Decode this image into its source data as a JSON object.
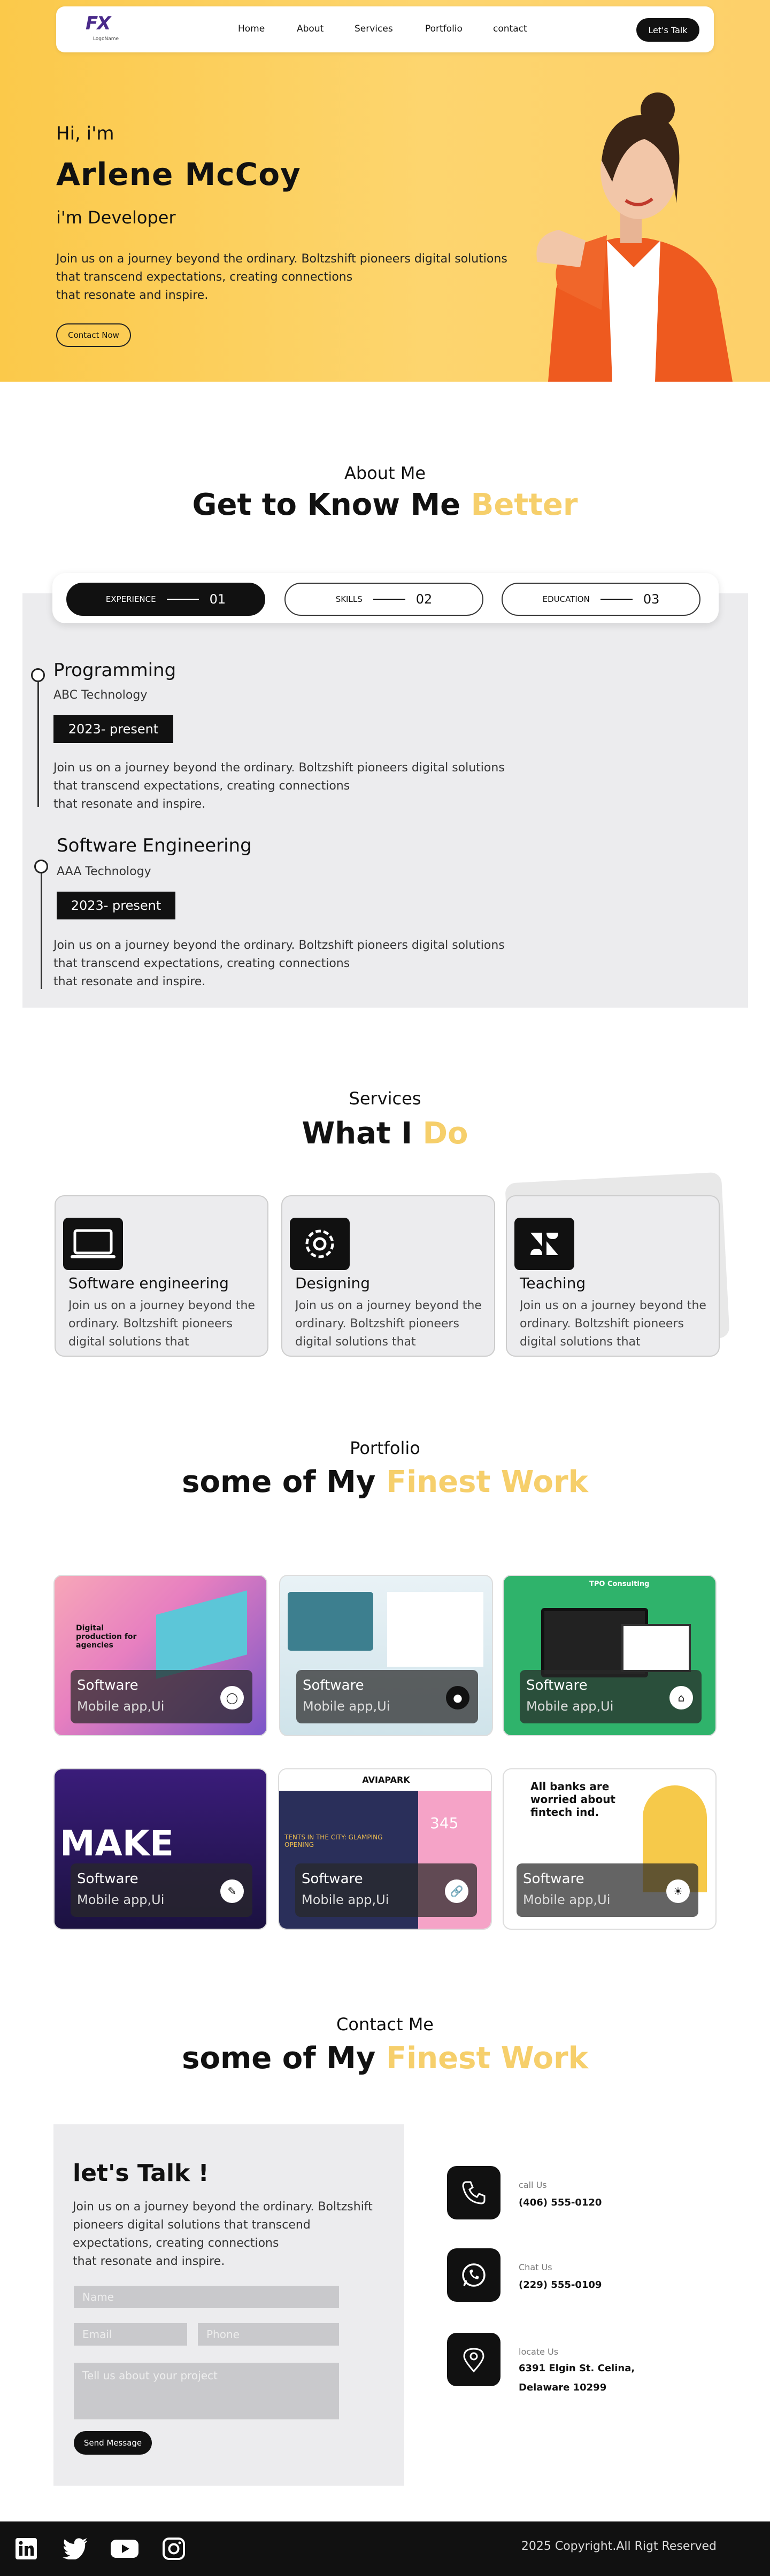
{
  "nav": {
    "logo_mark": "FX",
    "logo_sub": "LogoName",
    "links": [
      "Home",
      "About",
      "Services",
      "Portfolio",
      "contact"
    ],
    "cta": "Let's Talk"
  },
  "hero": {
    "greeting": "Hi, i'm",
    "name": "Arlene McCoy",
    "role": "i'm Developer",
    "desc_lines": [
      "Join us on a journey beyond the ordinary. Boltzshift pioneers digital solutions",
      "that transcend expectations, creating connections",
      "that resonate and inspire."
    ],
    "button": "Contact Now"
  },
  "about": {
    "sub": "About Me",
    "title_main": "Get to Know Me",
    "title_highlight": "Better",
    "tabs": [
      {
        "label": "EXPERIENCE",
        "num": "01"
      },
      {
        "label": "SKILLS",
        "num": "02"
      },
      {
        "label": "EDUCATION",
        "num": "03"
      }
    ],
    "items": [
      {
        "title": "Programming",
        "org": "ABC Technology",
        "date": "2023- present",
        "desc_lines": [
          "Join us on a journey beyond the ordinary. Boltzshift pioneers digital solutions",
          "that transcend expectations, creating connections",
          "that resonate and inspire."
        ]
      },
      {
        "title": "Software Engineering",
        "org": "AAA Technology",
        "date": "2023- present",
        "desc_lines": [
          "Join us on a journey beyond the ordinary. Boltzshift pioneers digital solutions",
          "that transcend expectations, creating connections",
          "that resonate and inspire."
        ]
      }
    ]
  },
  "services": {
    "sub": "Services",
    "title_main": "What I",
    "title_highlight": "Do",
    "cards": [
      {
        "title": "Software engineering",
        "desc": "Join us on a journey beyond the ordinary. Boltzshift pioneers digital solutions that",
        "icon": "laptop-icon"
      },
      {
        "title": "Designing",
        "desc": "Join us on a journey beyond the ordinary. Boltzshift pioneers digital solutions that",
        "icon": "gear-icon"
      },
      {
        "title": "Teaching",
        "desc": "Join us on a journey beyond the ordinary. Boltzshift pioneers digital solutions that",
        "icon": "zendesk-icon"
      }
    ]
  },
  "portfolio": {
    "sub": "Portfolio",
    "title_main": "some of My",
    "title_highlight": "Finest Work",
    "items": [
      {
        "title": "Software",
        "subtitle": "Mobile app,Ui",
        "icon": "instagram-icon",
        "thumb_text": "Digital production for agencies"
      },
      {
        "title": "Software",
        "subtitle": "Mobile app,Ui",
        "icon": "android-icon",
        "thumb_text": ""
      },
      {
        "title": "Software",
        "subtitle": "Mobile app,Ui",
        "icon": "home-icon",
        "thumb_text": "TPO Consulting"
      },
      {
        "title": "Software",
        "subtitle": "Mobile app,Ui",
        "icon": "pen-icon",
        "thumb_text": "MAKE"
      },
      {
        "title": "Software",
        "subtitle": "Mobile app,Ui",
        "icon": "link-icon",
        "thumb_text": "AVIAPARK"
      },
      {
        "title": "Software",
        "subtitle": "Mobile app,Ui",
        "icon": "sun-icon",
        "thumb_text": "All banks are worried about fintech ind."
      }
    ],
    "thumb_extra": {
      "tents": "TENTS IN THE CITY: GLAMPING OPENING",
      "num": "345"
    }
  },
  "contact": {
    "sub": "Contact Me",
    "title_main": "some of My",
    "title_highlight": "Finest Work",
    "box_title": "let's Talk !",
    "box_desc_lines": [
      "Join us on a journey beyond the ordinary. Boltzshift",
      "pioneers digital solutions that transcend",
      "expectations, creating connections",
      "that resonate and inspire."
    ],
    "placeholders": {
      "name": "Name",
      "email": "Email",
      "phone": "Phone",
      "project": "Tell us about your project"
    },
    "send": "Send Message",
    "info": [
      {
        "label": "call Us",
        "value_lines": [
          "(406) 555-0120"
        ],
        "icon": "phone-icon"
      },
      {
        "label": "Chat Us",
        "value_lines": [
          "(229) 555-0109"
        ],
        "icon": "whatsapp-icon"
      },
      {
        "label": "locate Us",
        "value_lines": [
          "6391 Elgin St. Celina,",
          "Delaware 10299"
        ],
        "icon": "location-pin-icon"
      }
    ]
  },
  "footer": {
    "social": [
      "linkedin-icon",
      "twitter-icon",
      "youtube-icon",
      "instagram-icon"
    ],
    "copyright": "2025 Copyright.All Rigt Reserved"
  },
  "colors": {
    "accent": "#f6cf6b",
    "hero_bg": "#fbc94a",
    "dark": "#111111",
    "panel": "#ececee"
  }
}
